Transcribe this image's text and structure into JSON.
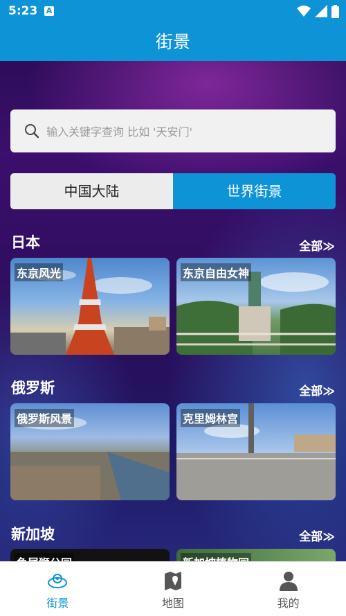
{
  "status_bar": {
    "time": "5:23",
    "notification_badge": "A"
  },
  "header": {
    "title": "街景"
  },
  "search": {
    "placeholder": "输入关键字查询 比如 '天安门'"
  },
  "tabs": [
    {
      "label": "中国大陆",
      "selected": false
    },
    {
      "label": "世界街景",
      "selected": true
    }
  ],
  "sections": [
    {
      "title": "日本",
      "more": "全部≫",
      "items": [
        {
          "label": "东京风光"
        },
        {
          "label": "东京自由女神"
        }
      ]
    },
    {
      "title": "俄罗斯",
      "more": "全部≫",
      "items": [
        {
          "label": "俄罗斯风景"
        },
        {
          "label": "克里姆林宫"
        }
      ]
    },
    {
      "title": "新加坡",
      "more": "全部≫",
      "items": [
        {
          "label": "鱼尾狮公园"
        },
        {
          "label": "新加坡植物园"
        }
      ]
    }
  ],
  "bottom_nav": [
    {
      "label": "街景",
      "icon": "streetview-icon",
      "active": true
    },
    {
      "label": "地图",
      "icon": "map-icon",
      "active": false
    },
    {
      "label": "我的",
      "icon": "profile-icon",
      "active": false
    }
  ],
  "colors": {
    "accent": "#0d93d6"
  }
}
